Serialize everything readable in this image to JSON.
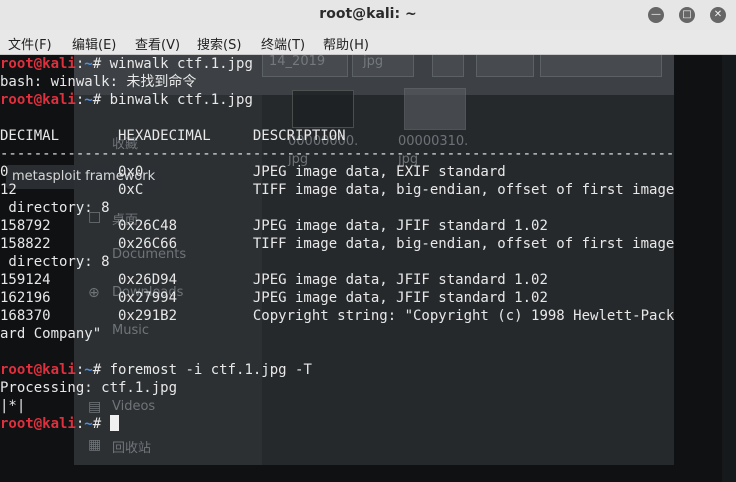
{
  "window": {
    "title": "root@kali: ~",
    "menu": [
      "文件(F)",
      "编辑(E)",
      "查看(V)",
      "搜索(S)",
      "终端(T)",
      "帮助(H)"
    ]
  },
  "background": {
    "tooltip": "metasploit framework",
    "sidebar": [
      "收藏",
      "桌面",
      "Documents",
      "Downloads",
      "Music",
      "Videos",
      "回收站"
    ],
    "path_frag": "14_2019",
    "type_combo": "jpg",
    "file1_name": "00000000.\njpg",
    "file2_name": "00000310.\njpg"
  },
  "terminal": {
    "prompt_user": "root@kali",
    "prompt_path": "~",
    "prompt_sym": "# ",
    "lines": [
      {
        "kind": "cmd",
        "text": "winwalk ctf.1.jpg"
      },
      {
        "kind": "out",
        "text": "bash: winwalk: 未找到命令"
      },
      {
        "kind": "cmd",
        "text": "binwalk ctf.1.jpg"
      },
      {
        "kind": "out",
        "text": ""
      },
      {
        "kind": "out",
        "text": "DECIMAL       HEXADECIMAL     DESCRIPTION"
      },
      {
        "kind": "out",
        "text": "--------------------------------------------------------------------------------"
      },
      {
        "kind": "out",
        "text": "0             0x0             JPEG image data, EXIF standard"
      },
      {
        "kind": "out",
        "text": "12            0xC             TIFF image data, big-endian, offset of first image"
      },
      {
        "kind": "out",
        "text": " directory: 8"
      },
      {
        "kind": "out",
        "text": "158792        0x26C48         JPEG image data, JFIF standard 1.02"
      },
      {
        "kind": "out",
        "text": "158822        0x26C66         TIFF image data, big-endian, offset of first image"
      },
      {
        "kind": "out",
        "text": " directory: 8"
      },
      {
        "kind": "out",
        "text": "159124        0x26D94         JPEG image data, JFIF standard 1.02"
      },
      {
        "kind": "out",
        "text": "162196        0x27994         JPEG image data, JFIF standard 1.02"
      },
      {
        "kind": "out",
        "text": "168370        0x291B2         Copyright string: \"Copyright (c) 1998 Hewlett-Pack"
      },
      {
        "kind": "out",
        "text": "ard Company\""
      },
      {
        "kind": "out",
        "text": ""
      },
      {
        "kind": "cmd",
        "text": "foremost -i ctf.1.jpg -T"
      },
      {
        "kind": "out",
        "text": "Processing: ctf.1.jpg"
      },
      {
        "kind": "out",
        "text": "|*|"
      },
      {
        "kind": "cmd",
        "text": "",
        "cursor": true
      }
    ]
  }
}
